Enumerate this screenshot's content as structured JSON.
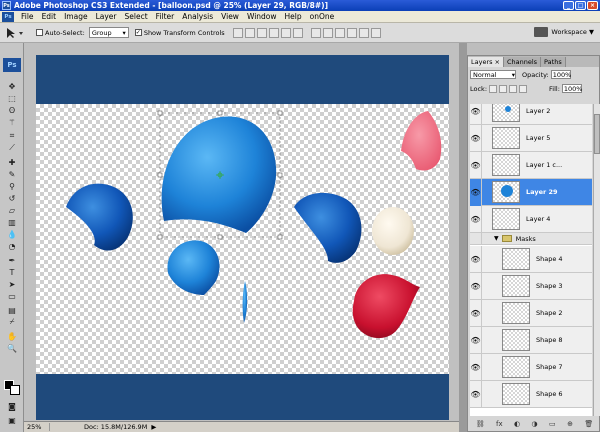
{
  "window": {
    "title": "Adobe Photoshop CS3 Extended - [balloon.psd @ 25% (Layer 29, RGB/8#)]",
    "app_icon": "Ps",
    "controls": [
      "_",
      "□",
      "×"
    ]
  },
  "menu": {
    "logo": "Ps",
    "items": [
      "File",
      "Edit",
      "Image",
      "Layer",
      "Select",
      "Filter",
      "Analysis",
      "View",
      "Window",
      "Help",
      "onOne"
    ]
  },
  "options": {
    "auto_select_label": "Auto-Select:",
    "auto_select_value": "Group",
    "show_transform_label": "Show Transform Controls",
    "show_transform_checked": "✓",
    "workspace_label": "Workspace ▼"
  },
  "toolbox": {
    "badge": "Ps",
    "tools": [
      "move-tool",
      "marquee-tool",
      "lasso-tool",
      "magic-wand-tool",
      "crop-tool",
      "slice-tool",
      "healing-brush-tool",
      "brush-tool",
      "clone-stamp-tool",
      "history-brush-tool",
      "eraser-tool",
      "gradient-tool",
      "blur-tool",
      "dodge-tool",
      "pen-tool",
      "type-tool",
      "path-selection-tool",
      "shape-tool",
      "notes-tool",
      "eyedropper-tool",
      "hand-tool",
      "zoom-tool"
    ]
  },
  "status": {
    "zoom": "25%",
    "doc": "Doc: 15.8M/126.9M",
    "arrow": "▶"
  },
  "colors": {
    "document_bg": "#1f4a7c",
    "selected_layer": "#3f86e5",
    "balloon_blue": "#1e83d8",
    "balloon_pink": "#e8566e",
    "balloon_red": "#c8102e",
    "balloon_cream": "#efe6d4"
  },
  "layers_panel": {
    "tabs": [
      {
        "label": "Layers",
        "close": "×"
      },
      {
        "label": "Channels"
      },
      {
        "label": "Paths"
      }
    ],
    "blend_mode": "Normal",
    "opacity_label": "Opacity:",
    "opacity_value": "100%",
    "lock_label": "Lock:",
    "fill_label": "Fill:",
    "fill_value": "100%",
    "layers": [
      {
        "name": "Layer 2"
      },
      {
        "name": "Layer 5"
      },
      {
        "name": "Layer 1 c..."
      },
      {
        "name": "Layer 29"
      },
      {
        "name": "Layer 4"
      }
    ],
    "group": {
      "name": "Masks",
      "toggle": "▼"
    },
    "group_layers": [
      {
        "name": "Shape 4"
      },
      {
        "name": "Shape 3"
      },
      {
        "name": "Shape 2"
      },
      {
        "name": "Shape 8"
      },
      {
        "name": "Shape 7"
      },
      {
        "name": "Shape 6"
      }
    ],
    "bottom_tools": [
      "⛓",
      "fx",
      "◐",
      "◑",
      "▭",
      "⊕",
      "🗑"
    ]
  }
}
